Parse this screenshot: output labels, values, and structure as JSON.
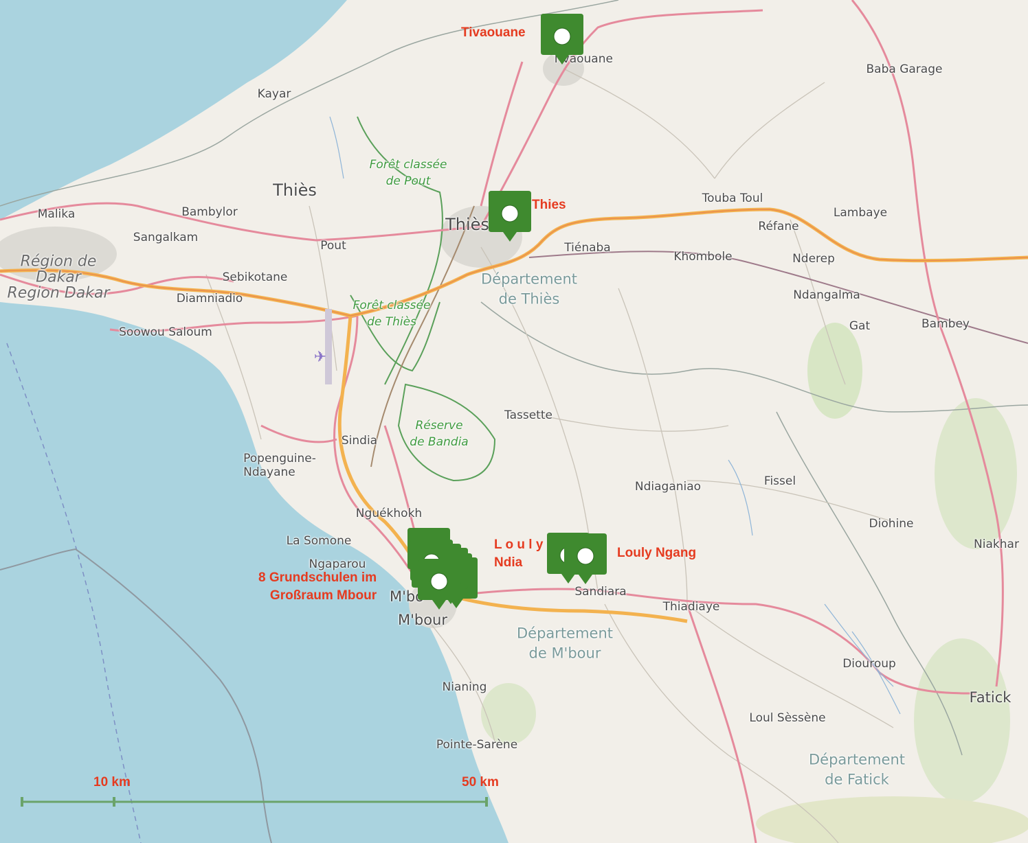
{
  "map": {
    "colors": {
      "land": "#f2efe9",
      "water": "#aad3df",
      "trunk_road": "#f3b24f",
      "primary_road": "#e892a2",
      "forest_boundary": "#5aa05a",
      "boundary": "#9aa6a0",
      "marker": "#3f8a2f",
      "marker_label": "#e53b20"
    }
  },
  "places": [
    {
      "id": "tivaouane-town",
      "text": "Tivaouane"
    },
    {
      "id": "baba-garage",
      "text": "Baba Garage"
    },
    {
      "id": "kayar",
      "text": "Kayar"
    },
    {
      "id": "foret-pout",
      "line1": "Forêt classée",
      "line2": "de Pout"
    },
    {
      "id": "thies-region",
      "text": "Thiès"
    },
    {
      "id": "thies-city",
      "text": "Thiès"
    },
    {
      "id": "malika",
      "text": "Malika"
    },
    {
      "id": "bambylor",
      "text": "Bambylor"
    },
    {
      "id": "sangalkam",
      "text": "Sangalkam"
    },
    {
      "id": "pout",
      "text": "Pout"
    },
    {
      "id": "touba-toul",
      "text": "Touba Toul"
    },
    {
      "id": "lambaye",
      "text": "Lambaye"
    },
    {
      "id": "refane",
      "text": "Réfane"
    },
    {
      "id": "tienaba",
      "text": "Tiénaba"
    },
    {
      "id": "khombole",
      "text": "Khombole"
    },
    {
      "id": "nderep",
      "text": "Nderep"
    },
    {
      "id": "region-dakar",
      "line1": "Région de",
      "line2": "Dakar",
      "line3": "Region Dakar"
    },
    {
      "id": "sebikotane",
      "text": "Sebikotane"
    },
    {
      "id": "diamniadio",
      "text": "Diamniadio"
    },
    {
      "id": "dept-thies",
      "line1": "Département",
      "line2": "de Thiès"
    },
    {
      "id": "ndangalma",
      "text": "Ndangalma"
    },
    {
      "id": "gat",
      "text": "Gat"
    },
    {
      "id": "bambey",
      "text": "Bambey"
    },
    {
      "id": "foret-thies",
      "line1": "Forêt classée",
      "line2": "de Thiès"
    },
    {
      "id": "soowou-saloum",
      "text": "Soowou Saloum"
    },
    {
      "id": "tassette",
      "text": "Tassette"
    },
    {
      "id": "reserve-bandia",
      "line1": "Réserve",
      "line2": "de Bandia"
    },
    {
      "id": "sindia",
      "text": "Sindia"
    },
    {
      "id": "popenguine",
      "line1": "Popenguine-",
      "line2": "Ndayane"
    },
    {
      "id": "ndiaganiao",
      "text": "Ndiaganiao"
    },
    {
      "id": "fissel",
      "text": "Fissel"
    },
    {
      "id": "diohine",
      "text": "Diohine"
    },
    {
      "id": "niakhar",
      "text": "Niakhar"
    },
    {
      "id": "nguekhokh",
      "text": "Nguékhokh"
    },
    {
      "id": "la-somone",
      "text": "La Somone"
    },
    {
      "id": "ngaparou",
      "text": "Ngaparou"
    },
    {
      "id": "mbour-small",
      "text": "M'bo"
    },
    {
      "id": "mbour",
      "text": "M'bour"
    },
    {
      "id": "sandiara",
      "text": "Sandiara"
    },
    {
      "id": "thiadiaye",
      "text": "Thiadiaye"
    },
    {
      "id": "dept-mbour",
      "line1": "Département",
      "line2": "de M'bour"
    },
    {
      "id": "diouroup",
      "text": "Diouroup"
    },
    {
      "id": "fatick",
      "text": "Fatick"
    },
    {
      "id": "nianing",
      "text": "Nianing"
    },
    {
      "id": "loul-sessene",
      "text": "Loul Sèssène"
    },
    {
      "id": "pointe-sarene",
      "text": "Pointe-Sarène"
    },
    {
      "id": "dept-fatick",
      "line1": "Département",
      "line2": "de Fatick"
    }
  ],
  "markers": {
    "tivaouane": {
      "label": "Tivaouane"
    },
    "thies": {
      "label": "Thies"
    },
    "louly_ndia": {
      "line1": "L o u l y",
      "line2": "Ndia"
    },
    "louly_ngang": {
      "label": "Louly Ngang"
    },
    "mbour_schools": {
      "line1": "8 Grundschulen im",
      "line2": "Großraum Mbour",
      "count": 8
    }
  },
  "scale": {
    "left_label": "10  km",
    "right_label": "50 km"
  }
}
